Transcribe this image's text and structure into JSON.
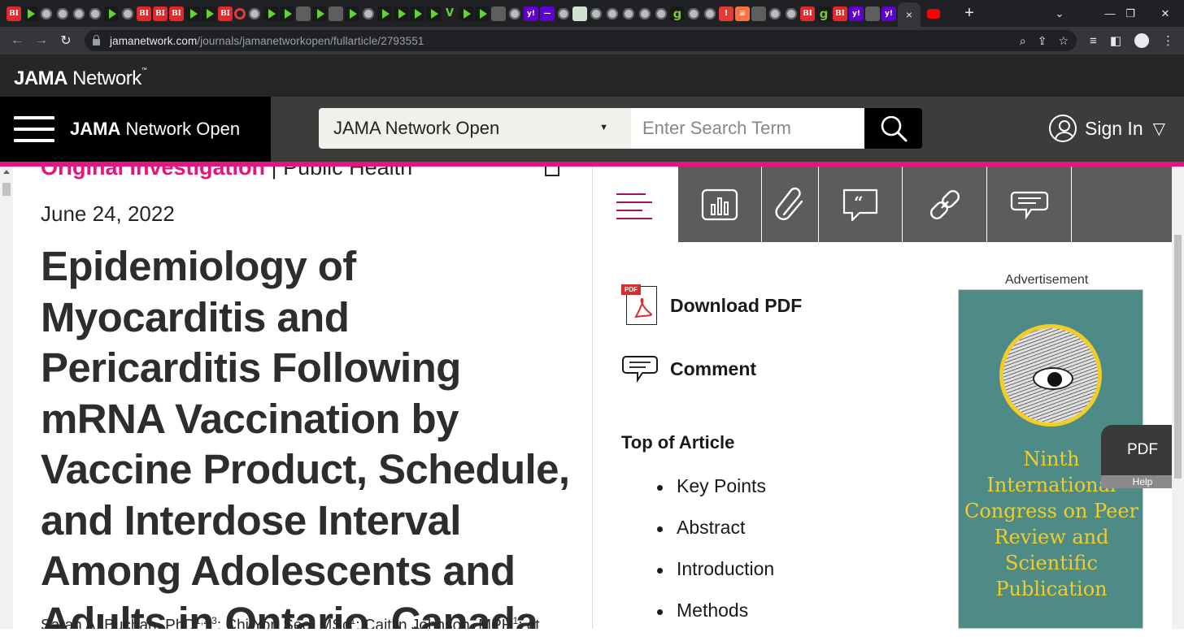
{
  "browser": {
    "tabs": {
      "favicons": [
        "BI",
        "play",
        "globe",
        "globe",
        "globe",
        "globe",
        "play",
        "globe",
        "BI",
        "BI",
        "BI",
        "play",
        "play",
        "BI",
        "refresh-c",
        "globe",
        "play",
        "play",
        "flag",
        "play",
        "flag",
        "play",
        "globe",
        "play",
        "play",
        "play",
        "play",
        "v",
        "play",
        "play",
        "flag",
        "globe",
        "yahoo",
        "purple-bar",
        "globe",
        "maps",
        "globe",
        "globe",
        "globe",
        "globe",
        "globe",
        "g",
        "globe",
        "globe",
        "red-mic",
        "orange-bars",
        "flag",
        "globe",
        "globe",
        "BI",
        "g",
        "BI",
        "yahoo",
        "cube",
        "yahoo"
      ],
      "active_close": "×",
      "after_active": "youtube",
      "new_tab": "+"
    },
    "window_controls": {
      "dropdown": "⌄",
      "minimize": "—",
      "restore": "❐",
      "close": "✕"
    },
    "url_host": "jamanetwork.com",
    "url_path": "/journals/jamanetworkopen/fullarticle/2793551"
  },
  "header": {
    "brand_bold": "JAMA",
    "brand_rest": " Network",
    "brand_tm": "™",
    "journal_bold": "JAMA",
    "journal_rest": " Network Open",
    "search_scope": "JAMA Network Open",
    "search_placeholder": "Enter Search Term",
    "signin_label": "Sign In"
  },
  "article": {
    "category": "Original Investigation",
    "separator": " | ",
    "subject": "Public Health",
    "date": "June 24, 2022",
    "title": "Epidemiology of Myocarditis and Pericarditis Following mRNA Vaccination by Vaccine Product, Schedule, and Interdose Interval Among Adolescents and Adults in Ontario, Canada",
    "authors": [
      {
        "name": "Sarah A. Buchan, PhD",
        "affil": "1,2,3",
        "sep": "; "
      },
      {
        "name": "Chi Yon Seo, MSc",
        "affil": "1",
        "sep": "; "
      },
      {
        "name": "Caitlin Johnson, MPH",
        "affil": "1",
        "sep": "; et"
      }
    ]
  },
  "sidebar": {
    "tools": [
      "figures-icon",
      "attachment-icon",
      "cite-icon",
      "permissions-link-icon",
      "comment-icon"
    ],
    "download_pdf": "Download PDF",
    "pdf_tag": "PDF",
    "comment": "Comment",
    "toc_heading": "Top of Article",
    "toc": [
      "Key Points",
      "Abstract",
      "Introduction",
      "Methods"
    ]
  },
  "ad": {
    "label": "Advertisement",
    "text": "Ninth International Congress on Peer Review and Scientific Publication"
  },
  "floating": {
    "pdf": "PDF",
    "help": "Help"
  },
  "colors": {
    "accent_pink": "#e6157e",
    "toc_icon": "#a3125c",
    "ad_bg": "#4e8b87",
    "ad_text": "#f2cd26"
  }
}
